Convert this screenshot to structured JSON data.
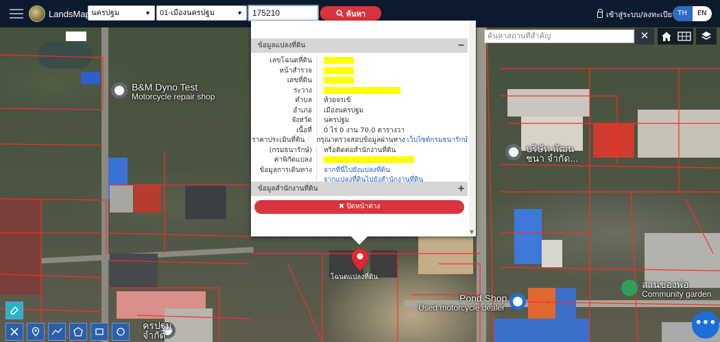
{
  "app": {
    "brand": "LandsMaps",
    "province_select": "นครปฐม",
    "district_select": "01-เมืองนครปฐม",
    "parcel_input_value": "175210",
    "search_label": "ค้นหา",
    "login_label": "เข้าสู่ระบบ/ลงทะเบียน",
    "lang": [
      "TH",
      "EN"
    ]
  },
  "poi_search": {
    "placeholder": "ค้นหาสถานที่สำคัญ",
    "clear": "✕"
  },
  "popup": {
    "section1_title": "ข้อมูลแปลงที่ดิน",
    "section1_sign": "−",
    "fields": {
      "deed_no_label": "เลขโฉนดที่ดิน",
      "survey_page_label": "หน้าสำรวจ",
      "land_no_label": "เลขที่ดิน",
      "ravang_label": "ระวาง",
      "subdistrict_label": "ตำบล",
      "subdistrict_value": "ห้วยจรเข้",
      "district_label": "อำเภอ",
      "district_value": "เมืองนครปฐม",
      "province_label": "จังหวัด",
      "province_value": "นครปฐม",
      "area_label": "เนื้อที่",
      "area_value": "0 ไร่ 0 งาน 70.0 ตารางวา",
      "price_label": "ราคาประเมินที่ดิน",
      "price_value": "กรุณาตรวจสอบข้อมูลผ่านทาง",
      "price_link": "เว็บไซต์กรมธนารักษ์",
      "price_label2": "(กรมธนารักษ์)",
      "price_value2": "หรือติดต่อสำนักงานที่ดิน",
      "coord_label": "ค่าพิกัดแปลง",
      "travel_label": "ข้อมูลการเดินทาง",
      "travel_link1": "จากที่นี่ไปยังแปลงที่ดิน",
      "travel_link2": "จากแปลงที่ดินไปยังสำนักงานที่ดิน"
    },
    "section2_title": "ข้อมูลสำนักงานที่ดิน",
    "section2_sign": "+",
    "close_label": "✖ ปิดหน้าต่าง"
  },
  "pois": {
    "bm_title": "B&M Dyno Test",
    "bm_sub": "Motorcycle repair shop",
    "company_title": "บริษัท พัฒน",
    "company_sub": "ชนา จำกัด...",
    "pond_title": "Pond Shop",
    "pond_sub": "Used motorcycle dealer",
    "garden_title": "สานของพ่อ",
    "garden_sub": "Community garden",
    "corner_title": "ครปฐม",
    "corner_sub": "จำกัด",
    "marker_label": "โฉนดแปลงที่ดิน"
  },
  "colors": {
    "topbar": "#0c1a2e",
    "accent_red": "#d9343e",
    "lang_active": "#2d6cc0",
    "parcel_line": "#ff2a2a"
  }
}
